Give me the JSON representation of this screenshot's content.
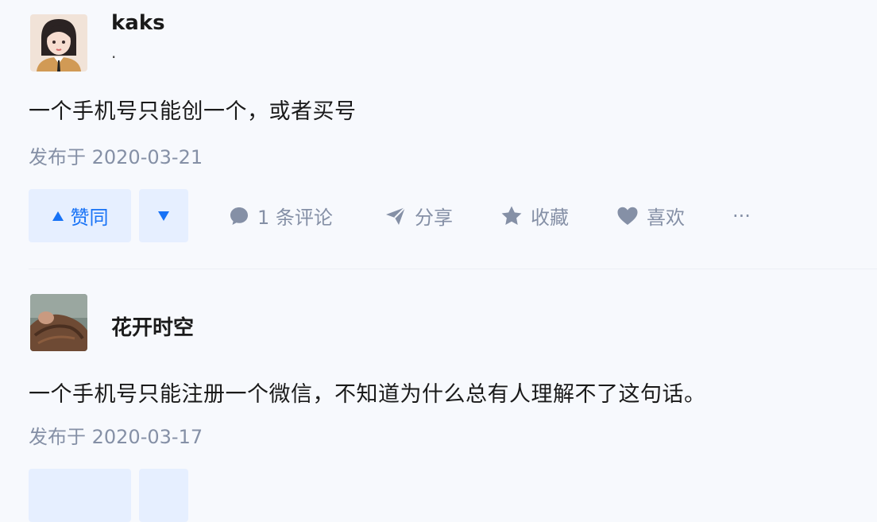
{
  "answers": [
    {
      "author": "kaks",
      "bio": "·",
      "content": "一个手机号只能创一个，或者买号",
      "published": "发布于 2020-03-21",
      "vote_up_label": "赞同",
      "comment_label": "1 条评论",
      "share_label": "分享",
      "favorite_label": "收藏",
      "like_label": "喜欢",
      "more_label": "···"
    },
    {
      "author": "花开时空",
      "content": "一个手机号只能注册一个微信，不知道为什么总有人理解不了这句话。",
      "published": "发布于 2020-03-17"
    }
  ],
  "icons": {
    "vote_up": "triangle-up-icon",
    "vote_down": "triangle-down-icon",
    "comment": "speech-bubble-icon",
    "share": "paper-plane-icon",
    "favorite": "star-icon",
    "like": "heart-icon"
  },
  "colors": {
    "accent": "#1772f6",
    "vote_bg": "#e6efff",
    "muted": "#8590a6",
    "page_bg": "#f7f9fd"
  }
}
